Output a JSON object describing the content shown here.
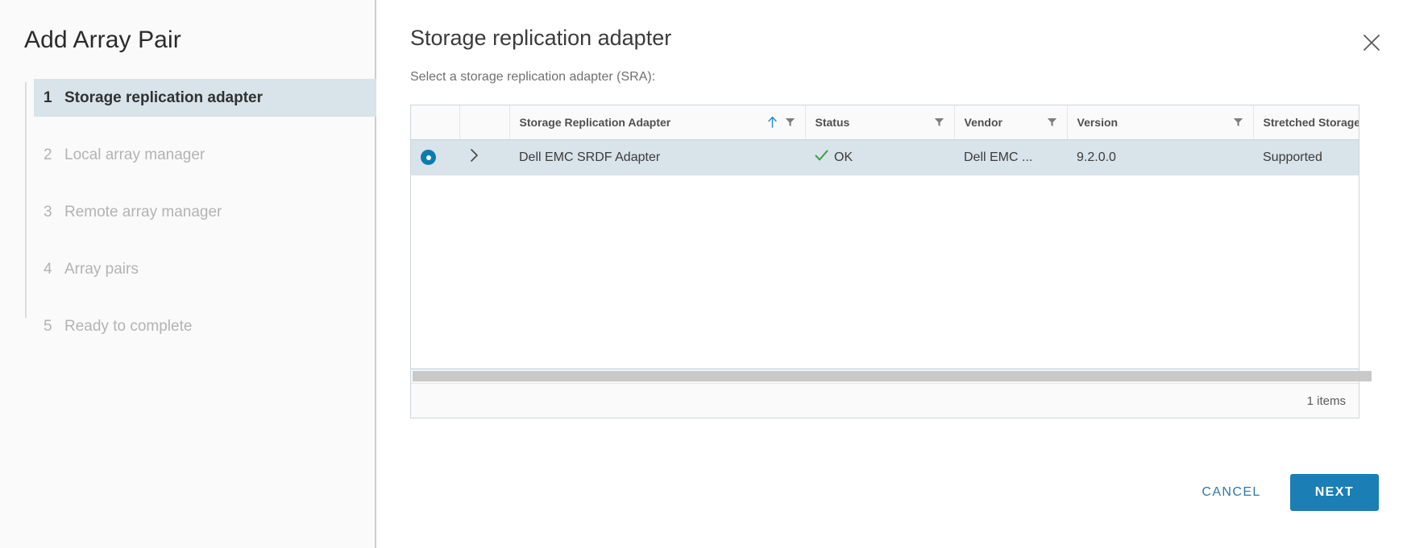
{
  "wizard": {
    "title": "Add Array Pair",
    "steps": [
      {
        "num": "1",
        "label": "Storage replication adapter",
        "state": "active"
      },
      {
        "num": "2",
        "label": "Local array manager",
        "state": "disabled"
      },
      {
        "num": "3",
        "label": "Remote array manager",
        "state": "disabled"
      },
      {
        "num": "4",
        "label": "Array pairs",
        "state": "disabled"
      },
      {
        "num": "5",
        "label": "Ready to complete",
        "state": "disabled"
      }
    ]
  },
  "content": {
    "title": "Storage replication adapter",
    "subtitle": "Select a storage replication adapter (SRA):",
    "close_icon": "close-icon"
  },
  "grid": {
    "columns": [
      {
        "label": "",
        "key": "select",
        "sort": "",
        "filter": false
      },
      {
        "label": "",
        "key": "expand",
        "sort": "",
        "filter": false
      },
      {
        "label": "Storage Replication Adapter",
        "key": "adapter",
        "sort": "asc",
        "filter": true
      },
      {
        "label": "Status",
        "key": "status",
        "sort": "",
        "filter": true
      },
      {
        "label": "Vendor",
        "key": "vendor",
        "sort": "",
        "filter": true
      },
      {
        "label": "Version",
        "key": "version",
        "sort": "",
        "filter": true
      },
      {
        "label": "Stretched Storage",
        "key": "stretched",
        "sort": "",
        "filter": false
      }
    ],
    "rows": [
      {
        "selected": true,
        "adapter": "Dell EMC SRDF Adapter",
        "status": "OK",
        "status_icon": "check-icon",
        "vendor": "Dell EMC ...",
        "version": "9.2.0.0",
        "stretched": "Supported"
      }
    ],
    "footer_count": "1 items",
    "sort_icon": "sort-ascending-icon",
    "filter_icon": "filter-funnel-icon",
    "expand_icon": "chevron-right-icon"
  },
  "actions": {
    "cancel_label": "CANCEL",
    "next_label": "NEXT"
  },
  "colors": {
    "accent": "#1b7eb5",
    "selected_row": "#d8e3ea",
    "status_ok": "#3aa03a",
    "link": "#2a7aa8"
  }
}
